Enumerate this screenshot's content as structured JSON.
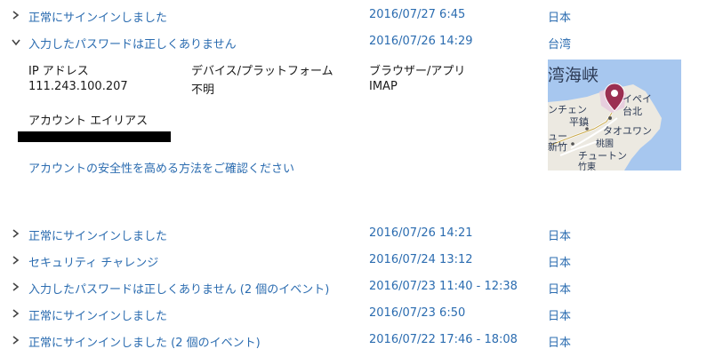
{
  "activities": [
    {
      "expanded": false,
      "title": "正常にサインインしました",
      "datetime": "2016/07/27 6:45",
      "location": "日本"
    },
    {
      "expanded": true,
      "title": "入力したパスワードは正しくありません",
      "datetime": "2016/07/26 14:29",
      "location": "台湾"
    },
    {
      "expanded": false,
      "title": "正常にサインインしました",
      "datetime": "2016/07/26 14:21",
      "location": "日本"
    },
    {
      "expanded": false,
      "title": "セキュリティ チャレンジ",
      "datetime": "2016/07/24 13:12",
      "location": "日本"
    },
    {
      "expanded": false,
      "title": "入力したパスワードは正しくありません (2 個のイベント)",
      "datetime": "2016/07/23 11:40 - 12:38",
      "location": "日本"
    },
    {
      "expanded": false,
      "title": "正常にサインインしました",
      "datetime": "2016/07/23 6:50",
      "location": "日本"
    },
    {
      "expanded": false,
      "title": "正常にサインインしました (2 個のイベント)",
      "datetime": "2016/07/22 17:46 - 18:08",
      "location": "日本"
    }
  ],
  "details": {
    "ip_label": "IP アドレス",
    "ip_value": "111.243.100.207",
    "device_label": "デバイス/プラットフォーム",
    "device_value": "不明",
    "browser_label": "ブラウザー/アプリ",
    "browser_value": "IMAP",
    "alias_label": "アカウント エイリアス",
    "security_link": "アカウントの安全性を高める方法をご確認ください"
  },
  "map": {
    "labels": {
      "strait": "湾海峡",
      "taipei_kana": "イペイ",
      "taipei": "台北",
      "chen": "ンチェン",
      "heizhen": "平鎮",
      "taoyuan_kana": "タオユワン",
      "taoyuan": "桃園",
      "shinchiku": "新竹",
      "chuutonn": "チュートン",
      "chikutou": "竹東",
      "yu": "ュー"
    },
    "colors": {
      "sea": "#a7c7ef",
      "land": "#ece9e1",
      "pin": "#9b2f52"
    }
  }
}
